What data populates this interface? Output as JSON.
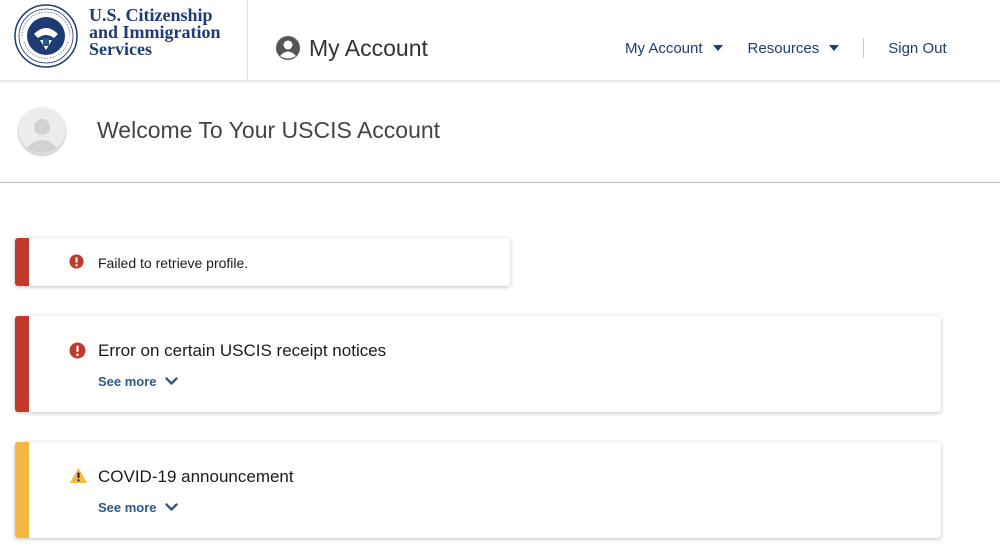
{
  "header": {
    "agency_lines": [
      "U.S. Citizenship",
      "and Immigration",
      "Services"
    ],
    "seal_icon": "dhs-seal-icon",
    "account_title": "My Account",
    "nav": {
      "my_account": "My Account",
      "resources": "Resources",
      "sign_out": "Sign Out"
    }
  },
  "welcome": {
    "title": "Welcome To Your USCIS Account",
    "avatar_icon": "avatar-placeholder-icon"
  },
  "alerts": [
    {
      "type": "error",
      "message": "Failed to retrieve profile.",
      "see_more": ""
    },
    {
      "type": "error",
      "message": "Error on certain USCIS receipt notices",
      "see_more": "See more"
    },
    {
      "type": "warning",
      "message": "COVID-19 announcement",
      "see_more": "See more"
    }
  ],
  "colors": {
    "brand_navy": "#1f3b73",
    "link_blue": "#2a5a8c",
    "error_red": "#c0392b",
    "warning_yellow": "#f4b840"
  }
}
